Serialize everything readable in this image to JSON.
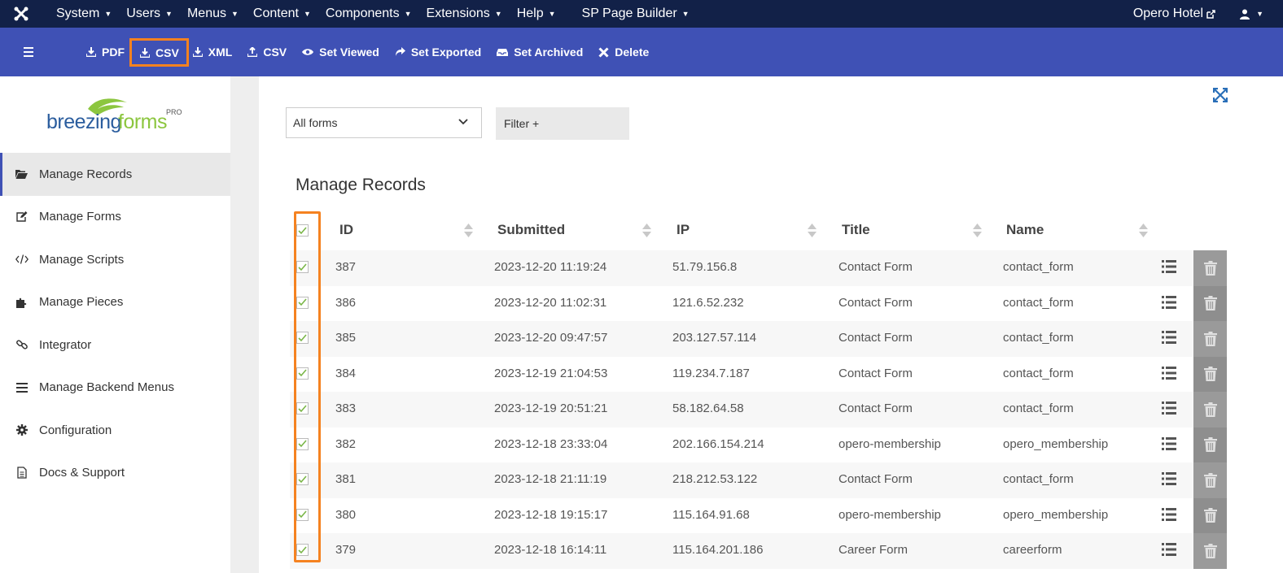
{
  "topnav": {
    "menus": [
      "System",
      "Users",
      "Menus",
      "Content",
      "Components",
      "Extensions",
      "Help"
    ],
    "page_builder": "SP Page Builder",
    "site_name": "Opero Hotel"
  },
  "toolbar": {
    "buttons": [
      {
        "label": "PDF",
        "icon": "download-icon"
      },
      {
        "label": "CSV",
        "icon": "download-icon",
        "highlighted": true
      },
      {
        "label": "XML",
        "icon": "download-icon"
      },
      {
        "label": "CSV",
        "icon": "upload-icon"
      },
      {
        "label": "Set Viewed",
        "icon": "eye-icon"
      },
      {
        "label": "Set Exported",
        "icon": "share-icon"
      },
      {
        "label": "Set Archived",
        "icon": "archive-icon"
      },
      {
        "label": "Delete",
        "icon": "close-icon"
      }
    ],
    "highlight_color": "#f58220"
  },
  "brand": {
    "part1": "breezing",
    "part2": "forms",
    "badge": "PRO"
  },
  "sidebar": {
    "items": [
      {
        "label": "Manage Records",
        "icon": "folder-open-icon",
        "active": true
      },
      {
        "label": "Manage Forms",
        "icon": "edit-icon"
      },
      {
        "label": "Manage Scripts",
        "icon": "code-icon"
      },
      {
        "label": "Manage Pieces",
        "icon": "puzzle-icon"
      },
      {
        "label": "Integrator",
        "icon": "link-icon"
      },
      {
        "label": "Manage Backend Menus",
        "icon": "bars-icon"
      },
      {
        "label": "Configuration",
        "icon": "gear-icon"
      },
      {
        "label": "Docs & Support",
        "icon": "file-icon"
      }
    ]
  },
  "filters": {
    "form_select": "All forms",
    "filter_button": "Filter +"
  },
  "main": {
    "title": "Manage Records"
  },
  "table": {
    "headers": [
      "ID",
      "Submitted",
      "IP",
      "Title",
      "Name"
    ],
    "rows": [
      {
        "id": "387",
        "submitted": "2023-12-20 11:19:24",
        "ip": "51.79.156.8",
        "title": "Contact Form",
        "name": "contact_form"
      },
      {
        "id": "386",
        "submitted": "2023-12-20 11:02:31",
        "ip": "121.6.52.232",
        "title": "Contact Form",
        "name": "contact_form"
      },
      {
        "id": "385",
        "submitted": "2023-12-20 09:47:57",
        "ip": "203.127.57.114",
        "title": "Contact Form",
        "name": "contact_form"
      },
      {
        "id": "384",
        "submitted": "2023-12-19 21:04:53",
        "ip": "119.234.7.187",
        "title": "Contact Form",
        "name": "contact_form"
      },
      {
        "id": "383",
        "submitted": "2023-12-19 20:51:21",
        "ip": "58.182.64.58",
        "title": "Contact Form",
        "name": "contact_form"
      },
      {
        "id": "382",
        "submitted": "2023-12-18 23:33:04",
        "ip": "202.166.154.214",
        "title": "opero-membership",
        "name": "opero_membership"
      },
      {
        "id": "381",
        "submitted": "2023-12-18 21:11:19",
        "ip": "218.212.53.122",
        "title": "Contact Form",
        "name": "contact_form"
      },
      {
        "id": "380",
        "submitted": "2023-12-18 19:15:17",
        "ip": "115.164.91.68",
        "title": "opero-membership",
        "name": "opero_membership"
      },
      {
        "id": "379",
        "submitted": "2023-12-18 16:14:11",
        "ip": "115.164.201.186",
        "title": "Career Form",
        "name": "careerform"
      }
    ]
  }
}
